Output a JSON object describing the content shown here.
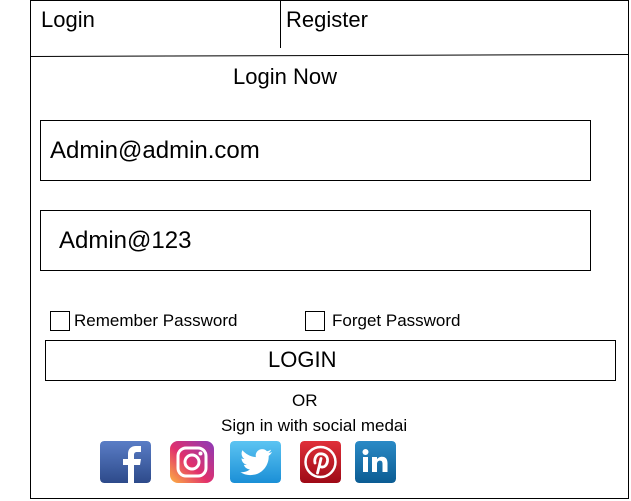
{
  "tabs": {
    "login_label": "Login",
    "register_label": "Register"
  },
  "form": {
    "title": "Login Now",
    "email_value": "Admin@admin.com",
    "password_value": "Admin@123",
    "remember_label": "Remember Password",
    "forget_label": "Forget Password",
    "login_button_label": "LOGIN",
    "or_text": "OR",
    "social_text": "Sign in with social medai"
  },
  "social_icons": [
    {
      "name": "facebook-icon",
      "color": "#3b5998"
    },
    {
      "name": "instagram-icon",
      "color": "#c13584"
    },
    {
      "name": "twitter-icon",
      "color": "#1da1f2"
    },
    {
      "name": "pinterest-icon",
      "color": "#bd081c"
    },
    {
      "name": "linkedin-icon",
      "color": "#0e76a8"
    }
  ]
}
